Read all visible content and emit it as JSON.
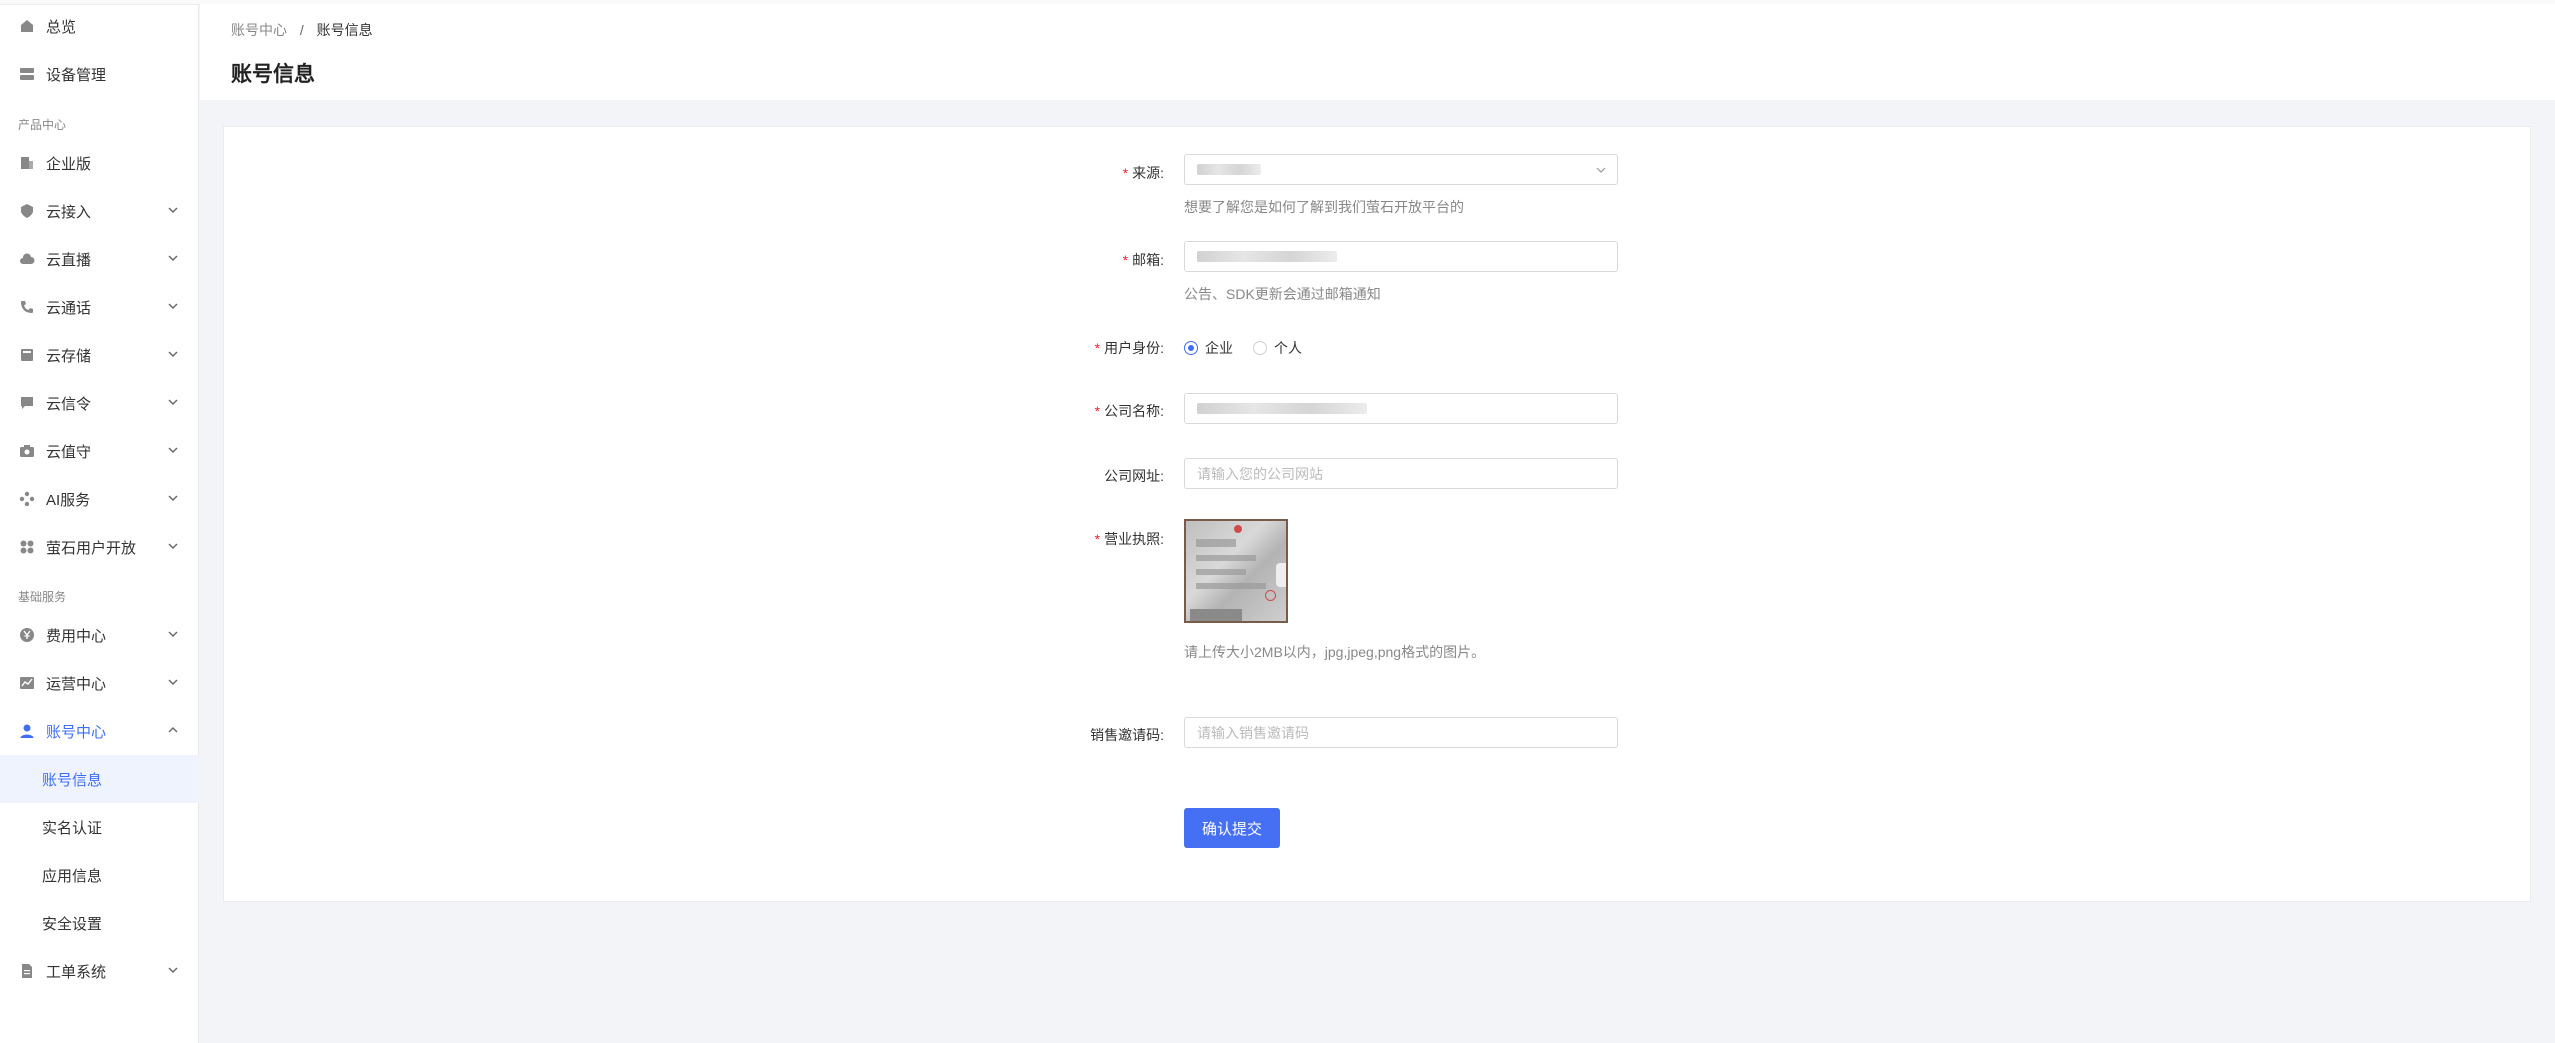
{
  "sidebar": {
    "items": [
      {
        "label": "总览",
        "icon": "home-icon"
      },
      {
        "label": "设备管理",
        "icon": "device-icon"
      }
    ],
    "section_product": "产品中心",
    "product_items": [
      {
        "label": "企业版",
        "icon": "building-icon"
      },
      {
        "label": "云接入",
        "icon": "shield-icon"
      },
      {
        "label": "云直播",
        "icon": "cloud-icon"
      },
      {
        "label": "云通话",
        "icon": "phone-icon"
      },
      {
        "label": "云存储",
        "icon": "storage-icon"
      },
      {
        "label": "云信令",
        "icon": "message-icon"
      },
      {
        "label": "云值守",
        "icon": "camera-icon"
      },
      {
        "label": "AI服务",
        "icon": "ai-icon"
      },
      {
        "label": "萤石用户开放",
        "icon": "grid-icon"
      }
    ],
    "section_basic": "基础服务",
    "basic_items": [
      {
        "label": "费用中心",
        "icon": "yen-icon"
      },
      {
        "label": "运营中心",
        "icon": "chart-icon"
      },
      {
        "label": "账号中心",
        "icon": "user-icon"
      }
    ],
    "account_sub": [
      {
        "label": "账号信息"
      },
      {
        "label": "实名认证"
      },
      {
        "label": "应用信息"
      },
      {
        "label": "安全设置"
      }
    ],
    "ticket": {
      "label": "工单系统",
      "icon": "ticket-icon"
    },
    "accent": "#3d6ff5"
  },
  "header": {
    "breadcrumb_parent": "账号中心",
    "breadcrumb_sep": "/",
    "breadcrumb_current": "账号信息",
    "title": "账号信息"
  },
  "form": {
    "source": {
      "label": "来源:",
      "value": "",
      "hint": "想要了解您是如何了解到我们萤石开放平台的"
    },
    "email": {
      "label": "邮箱:",
      "value": "",
      "hint": "公告、SDK更新会通过邮箱通知"
    },
    "identity": {
      "label": "用户身份:",
      "options": [
        "企业",
        "个人"
      ],
      "selected": "企业"
    },
    "company": {
      "label": "公司名称:",
      "value": ""
    },
    "website": {
      "label": "公司网址:",
      "placeholder": "请输入您的公司网站"
    },
    "license": {
      "label": "营业执照:",
      "hint": "请上传大小2MB以内，jpg,jpeg,png格式的图片。"
    },
    "invite": {
      "label": "销售邀请码:",
      "placeholder": "请输入销售邀请码"
    },
    "submit": "确认提交"
  }
}
